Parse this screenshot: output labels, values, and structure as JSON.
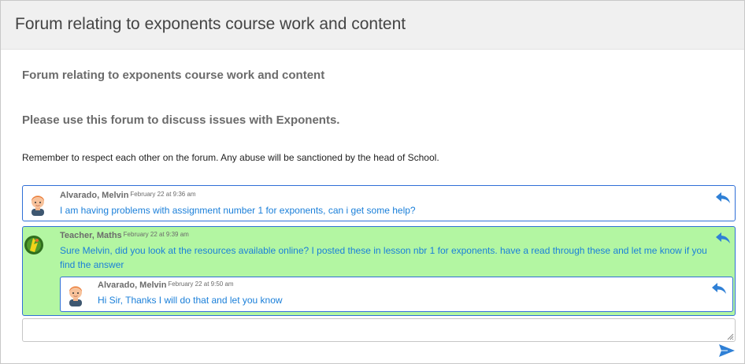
{
  "header": {
    "title": "Forum relating to exponents course work and content"
  },
  "forum": {
    "subtitle": "Forum relating to exponents course work and content",
    "heading": "Please use this forum to discuss issues with Exponents.",
    "notice": "Remember to respect each other on the forum. Any abuse will be sanctioned by the head of School."
  },
  "posts": [
    {
      "author": "Alvarado, Melvin",
      "timestamp": "February 22 at 9:36 am",
      "message": "I am having problems with assignment number 1 for exponents, can i get some help?",
      "avatar_icon": "student-avatar-icon"
    },
    {
      "author": "Teacher, Maths",
      "timestamp": "February 22 at 9:39 am",
      "message": "Sure Melvin, did you look at the resources available online? I posted these in lesson nbr 1 for exponents. have a read through these and let me know if you find the answer",
      "avatar_icon": "teacher-avatar-icon",
      "replies": [
        {
          "author": "Alvarado, Melvin",
          "timestamp": "February 22 at 9:50 am",
          "message": "Hi Sir, Thanks I will do that and let you know",
          "avatar_icon": "student-avatar-icon"
        }
      ]
    }
  ],
  "reply_input": {
    "value": "",
    "placeholder": ""
  },
  "colors": {
    "header_bg": "#f0f0f0",
    "post_border": "#2f6fd6",
    "message_text": "#1a7fd9",
    "teacher_post_bg": "#b3f6a2",
    "icon_blue": "#2f80d6"
  }
}
